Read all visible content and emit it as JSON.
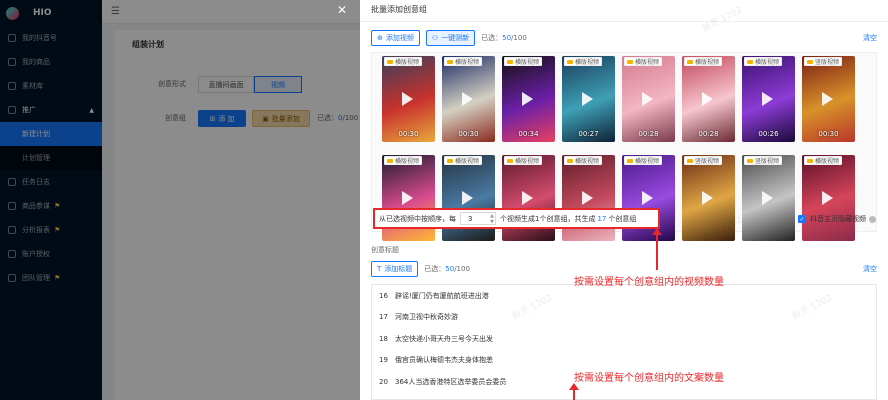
{
  "app": {
    "title": "HIO"
  },
  "sidebar": {
    "items": [
      {
        "label": "我的抖音号"
      },
      {
        "label": "我的商品"
      },
      {
        "label": "素材库"
      },
      {
        "label": "推广"
      },
      {
        "label": "新建计划"
      },
      {
        "label": "计划管理"
      },
      {
        "label": "任务日志"
      },
      {
        "label": "商品参谋"
      },
      {
        "label": "分析报表"
      },
      {
        "label": "账户授权"
      },
      {
        "label": "团队管理"
      }
    ]
  },
  "main": {
    "title": "组装计划",
    "creative_form_label": "创意形式",
    "creative_form_options": [
      "直播间画面",
      "视频"
    ],
    "creative_group_label": "创意组",
    "add_label": "添 加",
    "batch_add_label": "批量添加",
    "selected_prefix": "已选：",
    "selected_count": "0",
    "selected_total": "/100"
  },
  "drawer": {
    "title": "批量添加创意组",
    "add_video_label": "添加视频",
    "one_click_label": "一键测新",
    "selected_prefix": "已选：",
    "video_selected": "50",
    "video_total": "/100",
    "clear_label": "清空",
    "videos": [
      {
        "tag": "横版视频",
        "duration": "00:30",
        "colors": [
          "#3a3f5a",
          "#c8322e",
          "#e8a93b"
        ]
      },
      {
        "tag": "横版视频",
        "duration": "00:30",
        "colors": [
          "#1d2b64",
          "#d4d0c2",
          "#8a2a1e"
        ]
      },
      {
        "tag": "横版视频",
        "duration": "00:34",
        "colors": [
          "#111",
          "#6b1fa8",
          "#e8405e"
        ]
      },
      {
        "tag": "横版视频",
        "duration": "00:27",
        "colors": [
          "#1a3d5c",
          "#3e9fb6",
          "#0e2236"
        ]
      },
      {
        "tag": "横版视频",
        "duration": "00:28",
        "colors": [
          "#d47a8f",
          "#f3b6c3",
          "#7a3a4a"
        ]
      },
      {
        "tag": "横版视频",
        "duration": "00:28",
        "colors": [
          "#c2485c",
          "#f7c6cf",
          "#6a2a33"
        ]
      },
      {
        "tag": "横版视频",
        "duration": "00:26",
        "colors": [
          "#3b136e",
          "#8d3bd6",
          "#1a0a3a"
        ]
      },
      {
        "tag": "竖版视频",
        "duration": "00:30",
        "colors": [
          "#7a1c14",
          "#d9922a",
          "#b8362b"
        ]
      },
      {
        "tag": "横版视频",
        "duration": "",
        "colors": [
          "#1b1b2e",
          "#d94b8f",
          "#ffb833"
        ]
      },
      {
        "tag": "横版视频",
        "duration": "",
        "colors": [
          "#253341",
          "#4a7aa3",
          "#1a1a1a"
        ]
      },
      {
        "tag": "横版视频",
        "duration": "",
        "colors": [
          "#5a1a2e",
          "#d54b6e",
          "#2a0e18"
        ]
      },
      {
        "tag": "横版视频",
        "duration": "",
        "colors": [
          "#5e1e2a",
          "#c44a5e",
          "#ecb6c0"
        ]
      },
      {
        "tag": "横版视频",
        "duration": "",
        "colors": [
          "#4a1a8a",
          "#9a4ae0",
          "#22064a"
        ]
      },
      {
        "tag": "竖版视频",
        "duration": "",
        "colors": [
          "#6b2d14",
          "#e0a645",
          "#3a1e0a"
        ]
      },
      {
        "tag": "竖版视频",
        "duration": "",
        "colors": [
          "#4c4c4c",
          "#c5c5c5",
          "#222"
        ]
      },
      {
        "tag": "横版视频",
        "duration": "",
        "colors": [
          "#5a1028",
          "#d6455a",
          "#8a2a4a"
        ]
      }
    ],
    "order_text_1": "从已选视频中按顺序，每",
    "order_value": "3",
    "order_text_2": "个视频生成1个创意组，共生成",
    "order_count": "17",
    "order_text_3": "个创意组",
    "hide_label": "抖音主页隐藏视频",
    "titles_section_label": "创意标题",
    "add_title_label": "添加标题",
    "title_selected": "50",
    "title_total": "/100",
    "titles": [
      {
        "n": "16",
        "text": "辟谣!厦门仍有厦航航班进出港"
      },
      {
        "n": "17",
        "text": "河南卫视中秋奇妙游"
      },
      {
        "n": "18",
        "text": "太空快递小哥天舟三号今天出发"
      },
      {
        "n": "19",
        "text": "俄官员确认梅德韦杰夫身体抱恙"
      },
      {
        "n": "20",
        "text": "364人当选香港特区选举委员会委员"
      }
    ]
  },
  "annotations": {
    "video_note": "按需设置每个创意组内的视频数量",
    "title_note": "按需设置每个创意组内的文案数量"
  },
  "watermark": "鲸灵 1202"
}
